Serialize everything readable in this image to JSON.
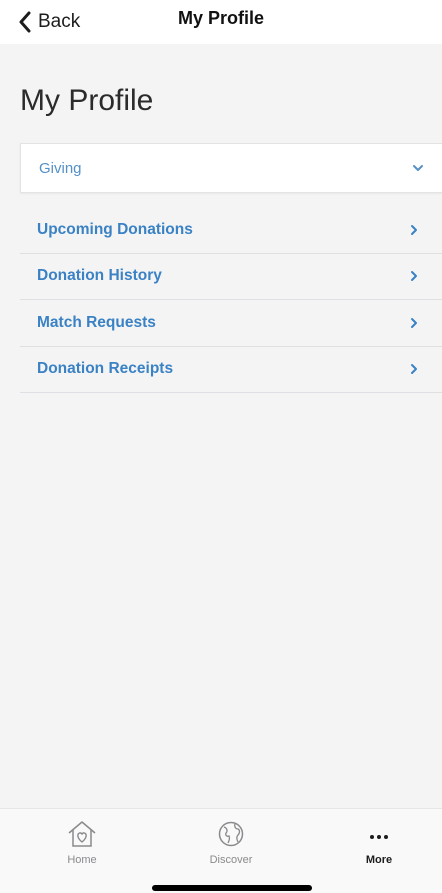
{
  "nav": {
    "back_label": "Back",
    "title": "My Profile"
  },
  "page": {
    "heading": "My Profile"
  },
  "section": {
    "label": "Giving",
    "expanded": true
  },
  "menu": {
    "items": [
      {
        "label": "Upcoming Donations",
        "icon": "chevron-right-icon"
      },
      {
        "label": "Donation History",
        "icon": "chevron-right-icon"
      },
      {
        "label": "Match Requests",
        "icon": "chevron-right-icon"
      },
      {
        "label": "Donation Receipts",
        "icon": "chevron-right-icon"
      }
    ]
  },
  "tabbar": {
    "tabs": [
      {
        "label": "Home",
        "icon": "home-heart-icon",
        "active": false
      },
      {
        "label": "Discover",
        "icon": "globe-icon",
        "active": false
      },
      {
        "label": "More",
        "icon": "more-dots-icon",
        "active": true
      }
    ]
  },
  "colors": {
    "accent": "#3a82c4",
    "section_text": "#5590c7",
    "background": "#f4f4f5",
    "nav_background": "#ffffff"
  }
}
